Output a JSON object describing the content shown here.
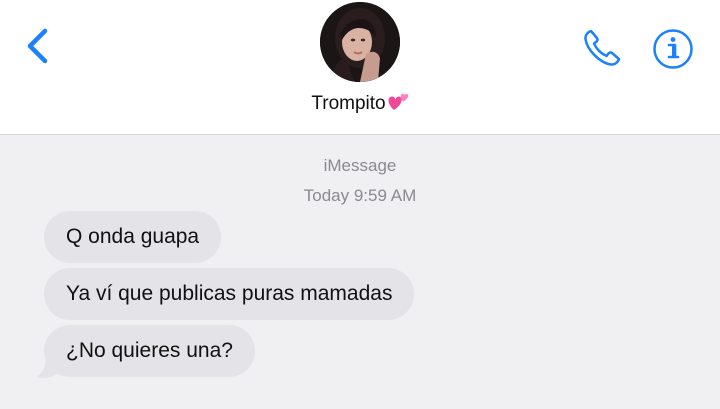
{
  "header": {
    "back_icon": "chevron-left-icon",
    "contact_name": "Trompito",
    "contact_emoji": "💕",
    "phone_icon": "phone-icon",
    "info_icon": "info-icon",
    "accent_color": "#1a82fb"
  },
  "thread": {
    "service_label": "iMessage",
    "timestamp": "Today 9:59 AM",
    "messages": [
      {
        "text": "Q onda guapa",
        "direction": "incoming"
      },
      {
        "text": "Ya ví que publicas puras mamadas",
        "direction": "incoming"
      },
      {
        "text": "¿No quieres una?",
        "direction": "incoming"
      }
    ],
    "bubble_color": "#e3e3e8",
    "background_color": "#f0f0f3"
  }
}
